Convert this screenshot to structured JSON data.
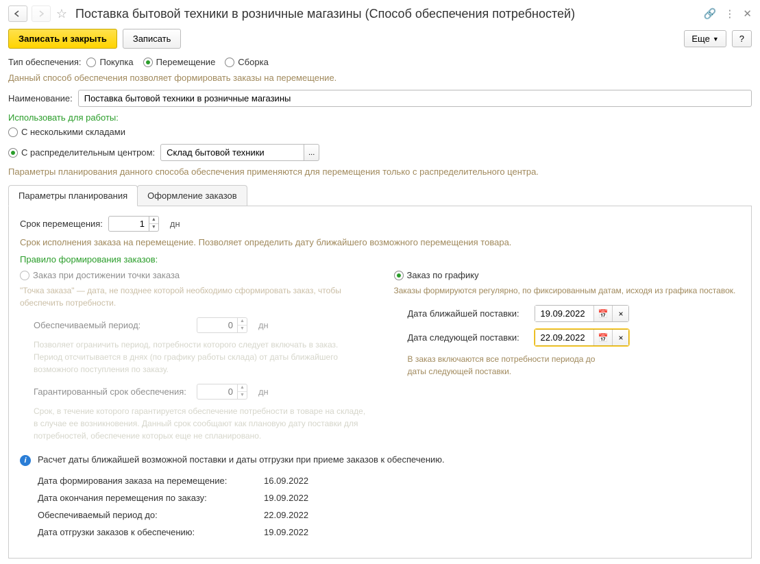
{
  "header": {
    "title": "Поставка бытовой техники в розничные магазины (Способ обеспечения потребностей)"
  },
  "toolbar": {
    "save_close": "Записать и закрыть",
    "save": "Записать",
    "more": "Еще",
    "help": "?"
  },
  "type_row": {
    "label": "Тип обеспечения:",
    "opt_purchase": "Покупка",
    "opt_transfer": "Перемещение",
    "opt_assembly": "Сборка"
  },
  "type_hint": "Данный способ обеспечения позволяет формировать заказы на перемещение.",
  "name_row": {
    "label": "Наименование:",
    "value": "Поставка бытовой техники в розничные магазины"
  },
  "usage": {
    "label": "Использовать для работы:",
    "opt_multi": "С несколькими складами",
    "opt_distrib": "С распределительным центром:",
    "distrib_value": "Склад бытовой техники",
    "hint": "Параметры планирования данного способа обеспечения применяются для перемещения только с распределительного центра."
  },
  "tabs": {
    "params": "Параметры планирования",
    "orders": "Оформление заказов"
  },
  "params": {
    "move_term_label": "Срок перемещения:",
    "move_term_value": "1",
    "days": "дн",
    "move_term_hint": "Срок исполнения заказа на перемещение. Позволяет определить дату ближайшего возможного перемещения товара.",
    "rule_label": "Правило формирования заказов:",
    "rule_point": "Заказ при достижении точки заказа",
    "rule_schedule": "Заказ по графику",
    "left": {
      "desc": "\"Точка заказа\" — дата, не позднее которой необходимо сформировать заказ, чтобы обеспечить потребности.",
      "provided_label": "Обеспечиваемый период:",
      "provided_value": "0",
      "provided_hint": "Позволяет ограничить период, потребности которого следует включать в заказ. Период отсчитывается в днях (по графику работы склада) от даты ближайшего возможного поступления по заказу.",
      "guarantee_label": "Гарантированный срок обеспечения:",
      "guarantee_value": "0",
      "guarantee_hint": "Срок, в течение которого гарантируется обеспечение потребности в товаре на складе, в случае ее возникновения. Данный срок сообщают как плановую дату поставки для потребностей, обеспечение которых еще не спланировано."
    },
    "right": {
      "desc": "Заказы формируются регулярно, по фиксированным датам, исходя из графика поставок.",
      "next_label": "Дата ближайшей поставки:",
      "next_value": "19.09.2022",
      "following_label": "Дата следующей поставки:",
      "following_value": "22.09.2022",
      "note": "В заказ включаются все потребности периода до даты следующей поставки."
    },
    "info_text": "Расчет даты ближайшей возможной поставки и даты отгрузки при приеме заказов к обеспечению.",
    "calc": {
      "r1_label": "Дата формирования заказа на перемещение:",
      "r1_val": "16.09.2022",
      "r2_label": "Дата окончания перемещения по заказу:",
      "r2_val": "19.09.2022",
      "r3_label": "Обеспечиваемый период до:",
      "r3_val": "22.09.2022",
      "r4_label": "Дата отгрузки заказов к обеспечению:",
      "r4_val": "19.09.2022"
    }
  }
}
